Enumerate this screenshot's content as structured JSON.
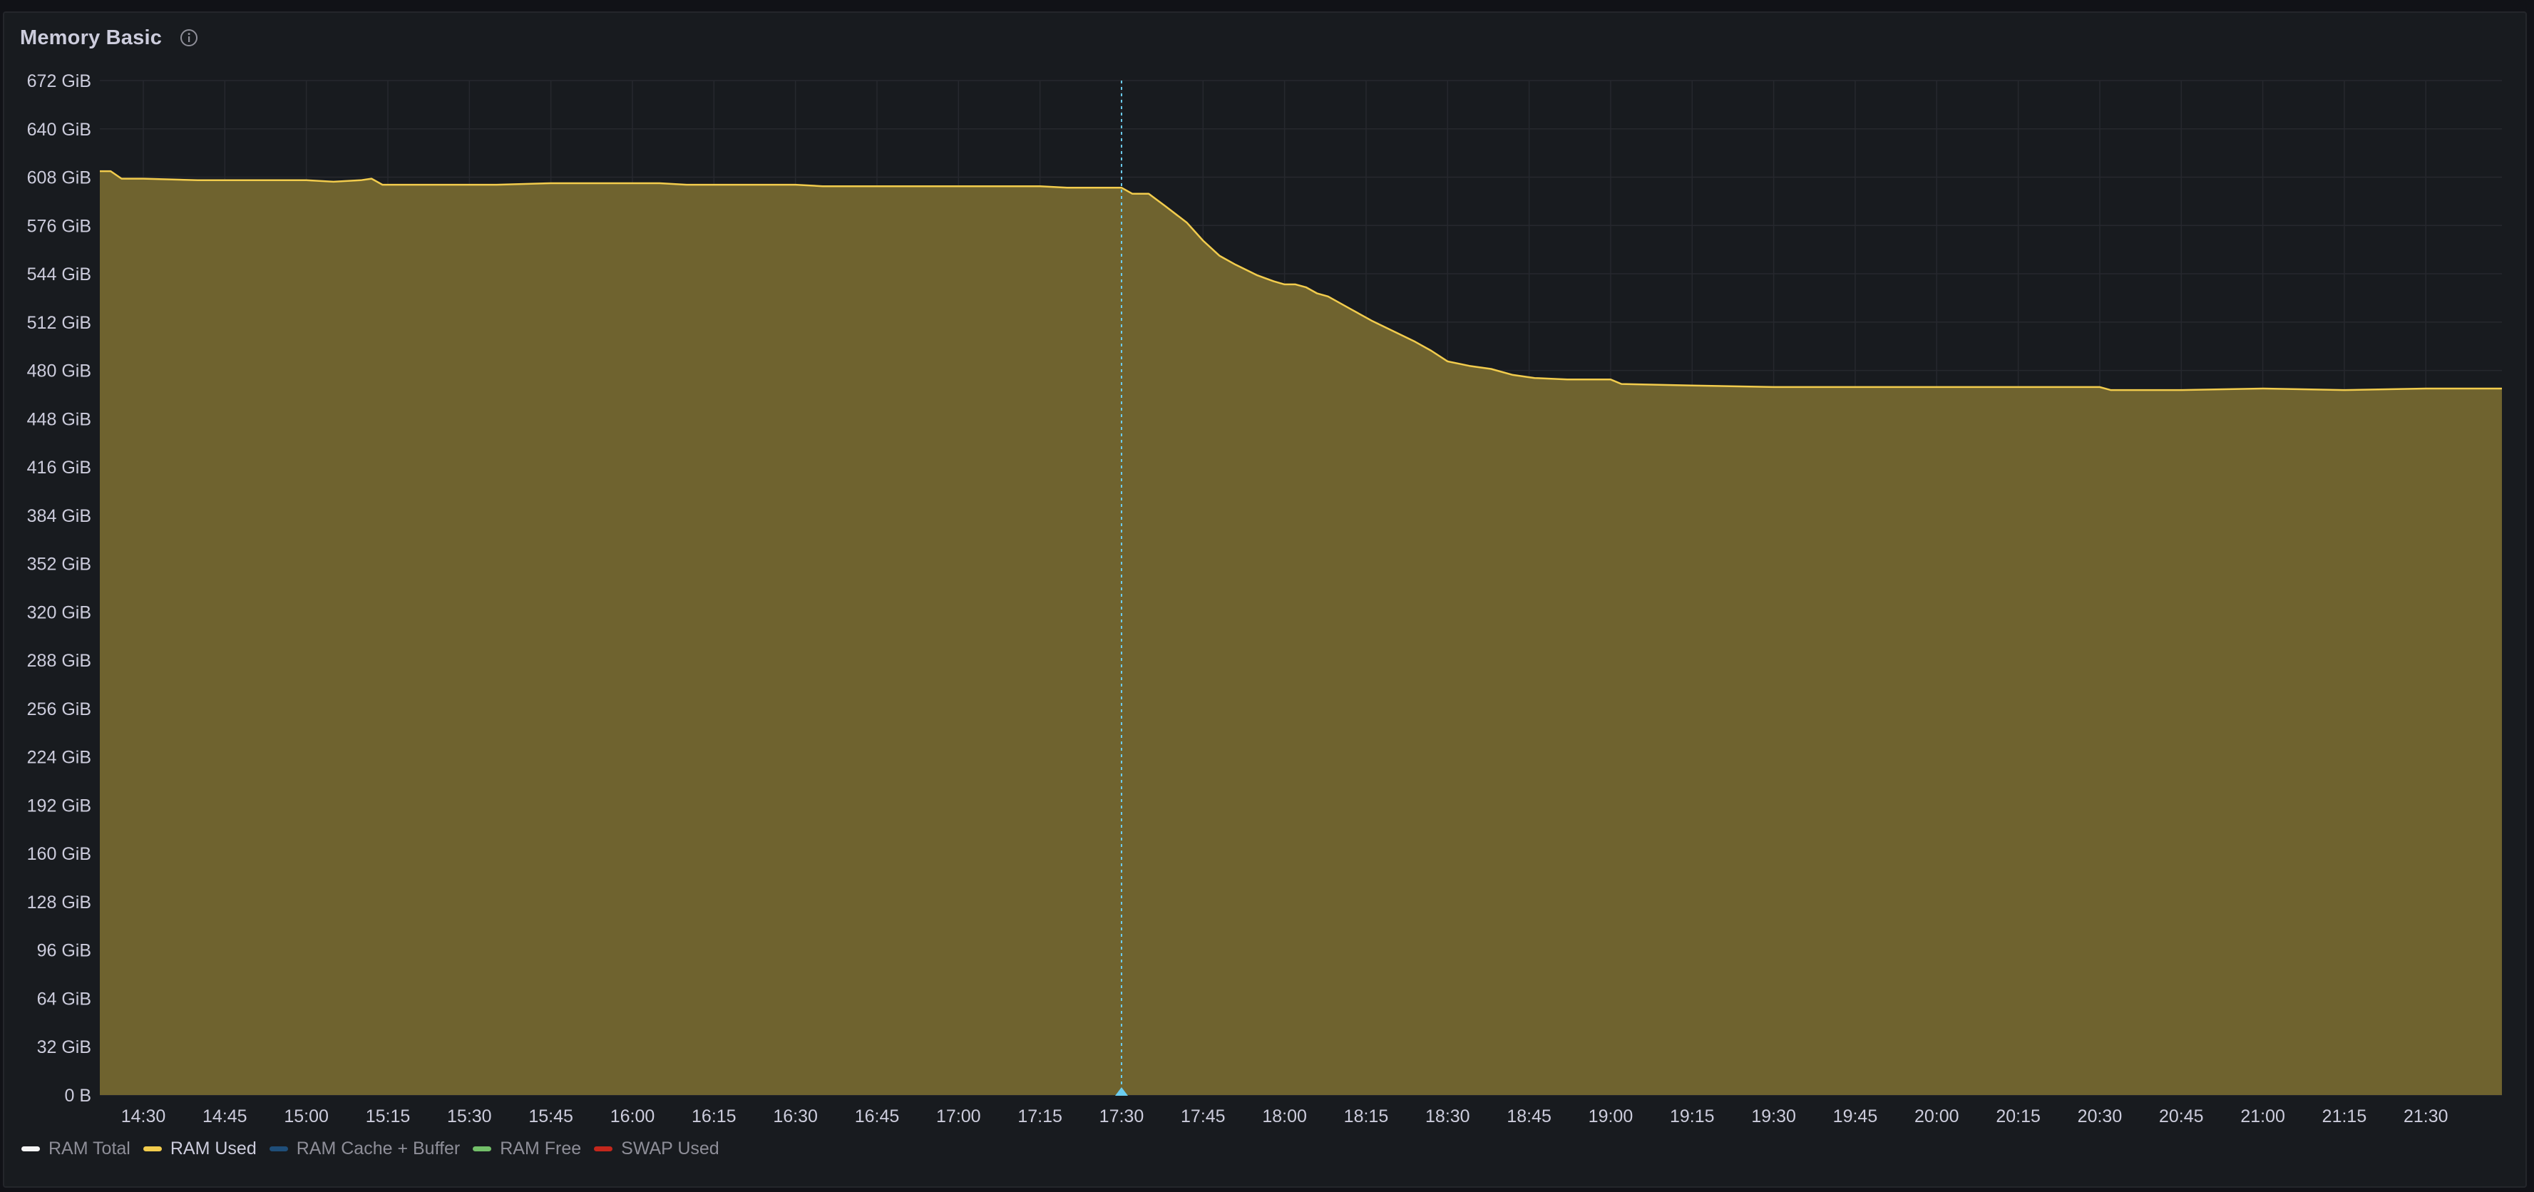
{
  "panel": {
    "title": "Memory Basic"
  },
  "icons": {
    "info": "info-circle-icon"
  },
  "colors": {
    "background": "#111217",
    "panel_bg": "#181b1f",
    "grid": "#26282e",
    "axis_text": "#ccccdc",
    "ram_used_line": "#f2cc4d",
    "ram_used_fill": "#6f632f",
    "crosshair": "#6ccdf0"
  },
  "chart_data": {
    "type": "area",
    "y_unit": "GiB",
    "ylim": [
      0,
      672
    ],
    "y_ticks": [
      {
        "value": 0,
        "label": "0 B"
      },
      {
        "value": 32,
        "label": "32 GiB"
      },
      {
        "value": 64,
        "label": "64 GiB"
      },
      {
        "value": 96,
        "label": "96 GiB"
      },
      {
        "value": 128,
        "label": "128 GiB"
      },
      {
        "value": 160,
        "label": "160 GiB"
      },
      {
        "value": 192,
        "label": "192 GiB"
      },
      {
        "value": 224,
        "label": "224 GiB"
      },
      {
        "value": 256,
        "label": "256 GiB"
      },
      {
        "value": 288,
        "label": "288 GiB"
      },
      {
        "value": 320,
        "label": "320 GiB"
      },
      {
        "value": 352,
        "label": "352 GiB"
      },
      {
        "value": 384,
        "label": "384 GiB"
      },
      {
        "value": 416,
        "label": "416 GiB"
      },
      {
        "value": 448,
        "label": "448 GiB"
      },
      {
        "value": 480,
        "label": "480 GiB"
      },
      {
        "value": 512,
        "label": "512 GiB"
      },
      {
        "value": 544,
        "label": "544 GiB"
      },
      {
        "value": 576,
        "label": "576 GiB"
      },
      {
        "value": 608,
        "label": "608 GiB"
      },
      {
        "value": 640,
        "label": "640 GiB"
      },
      {
        "value": 672,
        "label": "672 GiB"
      }
    ],
    "xlim": [
      "14:22",
      "21:44"
    ],
    "x_ticks": [
      "14:30",
      "14:45",
      "15:00",
      "15:15",
      "15:30",
      "15:45",
      "16:00",
      "16:15",
      "16:30",
      "16:45",
      "17:00",
      "17:15",
      "17:30",
      "17:45",
      "18:00",
      "18:15",
      "18:30",
      "18:45",
      "19:00",
      "19:15",
      "19:30",
      "19:45",
      "20:00",
      "20:15",
      "20:30",
      "20:45",
      "21:00",
      "21:15",
      "21:30"
    ],
    "grid": true,
    "crosshair_x": "17:30",
    "legend_position": "bottom-left",
    "legend": [
      {
        "name": "RAM Total",
        "color": "#f4f4f4",
        "active": false
      },
      {
        "name": "RAM Used",
        "color": "#f2cc4d",
        "active": true
      },
      {
        "name": "RAM Cache + Buffer",
        "color": "#1f4e79",
        "active": false
      },
      {
        "name": "RAM Free",
        "color": "#73bf69",
        "active": false
      },
      {
        "name": "SWAP Used",
        "color": "#c4271c",
        "active": false
      }
    ],
    "series": [
      {
        "name": "RAM Used",
        "color": "#f2cc4d",
        "points": [
          [
            "14:22",
            612
          ],
          [
            "14:24",
            612
          ],
          [
            "14:26",
            607
          ],
          [
            "14:30",
            607
          ],
          [
            "14:40",
            606
          ],
          [
            "15:00",
            606
          ],
          [
            "15:05",
            605
          ],
          [
            "15:10",
            606
          ],
          [
            "15:12",
            607
          ],
          [
            "15:14",
            603
          ],
          [
            "15:30",
            603
          ],
          [
            "15:35",
            603
          ],
          [
            "15:45",
            604
          ],
          [
            "16:00",
            604
          ],
          [
            "16:05",
            604
          ],
          [
            "16:10",
            603
          ],
          [
            "16:30",
            603
          ],
          [
            "16:35",
            602
          ],
          [
            "17:00",
            602
          ],
          [
            "17:15",
            602
          ],
          [
            "17:20",
            601
          ],
          [
            "17:29",
            601
          ],
          [
            "17:30",
            601
          ],
          [
            "17:32",
            597
          ],
          [
            "17:35",
            597
          ],
          [
            "17:38",
            589
          ],
          [
            "17:42",
            578
          ],
          [
            "17:45",
            566
          ],
          [
            "17:48",
            556
          ],
          [
            "17:51",
            550
          ],
          [
            "17:55",
            543
          ],
          [
            "17:58",
            539
          ],
          [
            "18:00",
            537
          ],
          [
            "18:02",
            537
          ],
          [
            "18:04",
            535
          ],
          [
            "18:06",
            531
          ],
          [
            "18:08",
            529
          ],
          [
            "18:12",
            521
          ],
          [
            "18:16",
            513
          ],
          [
            "18:20",
            506
          ],
          [
            "18:24",
            499
          ],
          [
            "18:27",
            493
          ],
          [
            "18:30",
            486
          ],
          [
            "18:34",
            483
          ],
          [
            "18:38",
            481
          ],
          [
            "18:42",
            477
          ],
          [
            "18:46",
            475
          ],
          [
            "18:52",
            474
          ],
          [
            "19:00",
            474
          ],
          [
            "19:02",
            471
          ],
          [
            "19:15",
            470
          ],
          [
            "19:30",
            469
          ],
          [
            "20:00",
            469
          ],
          [
            "20:30",
            469
          ],
          [
            "20:32",
            467
          ],
          [
            "20:45",
            467
          ],
          [
            "21:00",
            468
          ],
          [
            "21:15",
            467
          ],
          [
            "21:30",
            468
          ],
          [
            "21:44",
            468
          ]
        ]
      }
    ]
  }
}
